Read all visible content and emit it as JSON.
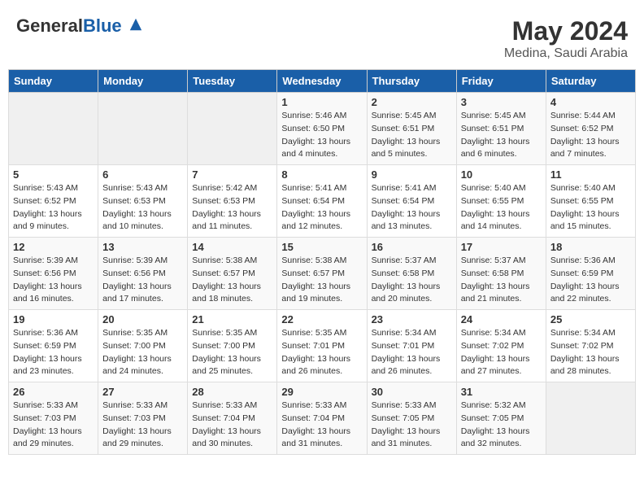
{
  "header": {
    "logo_general": "General",
    "logo_blue": "Blue",
    "month_year": "May 2024",
    "location": "Medina, Saudi Arabia"
  },
  "weekdays": [
    "Sunday",
    "Monday",
    "Tuesday",
    "Wednesday",
    "Thursday",
    "Friday",
    "Saturday"
  ],
  "weeks": [
    [
      {
        "day": "",
        "sunrise": "",
        "sunset": "",
        "daylight": ""
      },
      {
        "day": "",
        "sunrise": "",
        "sunset": "",
        "daylight": ""
      },
      {
        "day": "",
        "sunrise": "",
        "sunset": "",
        "daylight": ""
      },
      {
        "day": "1",
        "sunrise": "Sunrise: 5:46 AM",
        "sunset": "Sunset: 6:50 PM",
        "daylight": "Daylight: 13 hours and 4 minutes."
      },
      {
        "day": "2",
        "sunrise": "Sunrise: 5:45 AM",
        "sunset": "Sunset: 6:51 PM",
        "daylight": "Daylight: 13 hours and 5 minutes."
      },
      {
        "day": "3",
        "sunrise": "Sunrise: 5:45 AM",
        "sunset": "Sunset: 6:51 PM",
        "daylight": "Daylight: 13 hours and 6 minutes."
      },
      {
        "day": "4",
        "sunrise": "Sunrise: 5:44 AM",
        "sunset": "Sunset: 6:52 PM",
        "daylight": "Daylight: 13 hours and 7 minutes."
      }
    ],
    [
      {
        "day": "5",
        "sunrise": "Sunrise: 5:43 AM",
        "sunset": "Sunset: 6:52 PM",
        "daylight": "Daylight: 13 hours and 9 minutes."
      },
      {
        "day": "6",
        "sunrise": "Sunrise: 5:43 AM",
        "sunset": "Sunset: 6:53 PM",
        "daylight": "Daylight: 13 hours and 10 minutes."
      },
      {
        "day": "7",
        "sunrise": "Sunrise: 5:42 AM",
        "sunset": "Sunset: 6:53 PM",
        "daylight": "Daylight: 13 hours and 11 minutes."
      },
      {
        "day": "8",
        "sunrise": "Sunrise: 5:41 AM",
        "sunset": "Sunset: 6:54 PM",
        "daylight": "Daylight: 13 hours and 12 minutes."
      },
      {
        "day": "9",
        "sunrise": "Sunrise: 5:41 AM",
        "sunset": "Sunset: 6:54 PM",
        "daylight": "Daylight: 13 hours and 13 minutes."
      },
      {
        "day": "10",
        "sunrise": "Sunrise: 5:40 AM",
        "sunset": "Sunset: 6:55 PM",
        "daylight": "Daylight: 13 hours and 14 minutes."
      },
      {
        "day": "11",
        "sunrise": "Sunrise: 5:40 AM",
        "sunset": "Sunset: 6:55 PM",
        "daylight": "Daylight: 13 hours and 15 minutes."
      }
    ],
    [
      {
        "day": "12",
        "sunrise": "Sunrise: 5:39 AM",
        "sunset": "Sunset: 6:56 PM",
        "daylight": "Daylight: 13 hours and 16 minutes."
      },
      {
        "day": "13",
        "sunrise": "Sunrise: 5:39 AM",
        "sunset": "Sunset: 6:56 PM",
        "daylight": "Daylight: 13 hours and 17 minutes."
      },
      {
        "day": "14",
        "sunrise": "Sunrise: 5:38 AM",
        "sunset": "Sunset: 6:57 PM",
        "daylight": "Daylight: 13 hours and 18 minutes."
      },
      {
        "day": "15",
        "sunrise": "Sunrise: 5:38 AM",
        "sunset": "Sunset: 6:57 PM",
        "daylight": "Daylight: 13 hours and 19 minutes."
      },
      {
        "day": "16",
        "sunrise": "Sunrise: 5:37 AM",
        "sunset": "Sunset: 6:58 PM",
        "daylight": "Daylight: 13 hours and 20 minutes."
      },
      {
        "day": "17",
        "sunrise": "Sunrise: 5:37 AM",
        "sunset": "Sunset: 6:58 PM",
        "daylight": "Daylight: 13 hours and 21 minutes."
      },
      {
        "day": "18",
        "sunrise": "Sunrise: 5:36 AM",
        "sunset": "Sunset: 6:59 PM",
        "daylight": "Daylight: 13 hours and 22 minutes."
      }
    ],
    [
      {
        "day": "19",
        "sunrise": "Sunrise: 5:36 AM",
        "sunset": "Sunset: 6:59 PM",
        "daylight": "Daylight: 13 hours and 23 minutes."
      },
      {
        "day": "20",
        "sunrise": "Sunrise: 5:35 AM",
        "sunset": "Sunset: 7:00 PM",
        "daylight": "Daylight: 13 hours and 24 minutes."
      },
      {
        "day": "21",
        "sunrise": "Sunrise: 5:35 AM",
        "sunset": "Sunset: 7:00 PM",
        "daylight": "Daylight: 13 hours and 25 minutes."
      },
      {
        "day": "22",
        "sunrise": "Sunrise: 5:35 AM",
        "sunset": "Sunset: 7:01 PM",
        "daylight": "Daylight: 13 hours and 26 minutes."
      },
      {
        "day": "23",
        "sunrise": "Sunrise: 5:34 AM",
        "sunset": "Sunset: 7:01 PM",
        "daylight": "Daylight: 13 hours and 26 minutes."
      },
      {
        "day": "24",
        "sunrise": "Sunrise: 5:34 AM",
        "sunset": "Sunset: 7:02 PM",
        "daylight": "Daylight: 13 hours and 27 minutes."
      },
      {
        "day": "25",
        "sunrise": "Sunrise: 5:34 AM",
        "sunset": "Sunset: 7:02 PM",
        "daylight": "Daylight: 13 hours and 28 minutes."
      }
    ],
    [
      {
        "day": "26",
        "sunrise": "Sunrise: 5:33 AM",
        "sunset": "Sunset: 7:03 PM",
        "daylight": "Daylight: 13 hours and 29 minutes."
      },
      {
        "day": "27",
        "sunrise": "Sunrise: 5:33 AM",
        "sunset": "Sunset: 7:03 PM",
        "daylight": "Daylight: 13 hours and 29 minutes."
      },
      {
        "day": "28",
        "sunrise": "Sunrise: 5:33 AM",
        "sunset": "Sunset: 7:04 PM",
        "daylight": "Daylight: 13 hours and 30 minutes."
      },
      {
        "day": "29",
        "sunrise": "Sunrise: 5:33 AM",
        "sunset": "Sunset: 7:04 PM",
        "daylight": "Daylight: 13 hours and 31 minutes."
      },
      {
        "day": "30",
        "sunrise": "Sunrise: 5:33 AM",
        "sunset": "Sunset: 7:05 PM",
        "daylight": "Daylight: 13 hours and 31 minutes."
      },
      {
        "day": "31",
        "sunrise": "Sunrise: 5:32 AM",
        "sunset": "Sunset: 7:05 PM",
        "daylight": "Daylight: 13 hours and 32 minutes."
      },
      {
        "day": "",
        "sunrise": "",
        "sunset": "",
        "daylight": ""
      }
    ]
  ]
}
